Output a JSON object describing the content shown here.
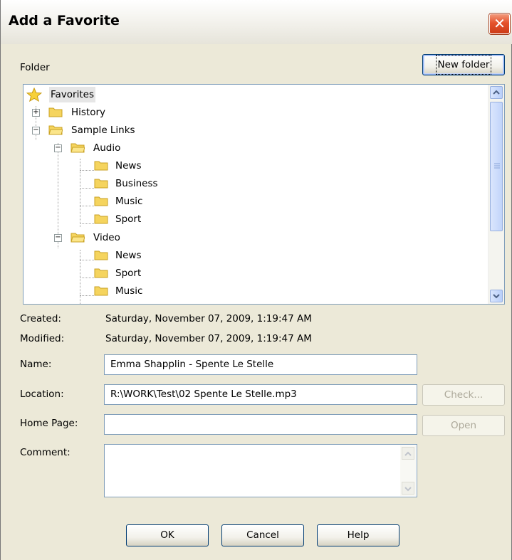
{
  "window": {
    "title": "Add a Favorite",
    "close_glyph": "✕"
  },
  "folder": {
    "label": "Folder",
    "new_folder_button": "New folder"
  },
  "tree": {
    "root": "Favorites",
    "items": [
      {
        "label": "History"
      },
      {
        "label": "Sample Links"
      },
      {
        "label": "Audio"
      },
      {
        "label": "News"
      },
      {
        "label": "Business"
      },
      {
        "label": "Music"
      },
      {
        "label": "Sport"
      },
      {
        "label": "Video"
      },
      {
        "label": "News"
      },
      {
        "label": "Sport"
      },
      {
        "label": "Music"
      }
    ]
  },
  "info": {
    "created_label": "Created:",
    "created_value": "Saturday, November 07, 2009, 1:19:47 AM",
    "modified_label": "Modified:",
    "modified_value": "Saturday, November 07, 2009, 1:19:47 AM"
  },
  "form": {
    "name_label": "Name:",
    "name_value": "Emma Shapplin - Spente Le Stelle",
    "location_label": "Location:",
    "location_value": "R:\\WORK\\Test\\02 Spente Le Stelle.mp3",
    "check_button": "Check...",
    "homepage_label": "Home Page:",
    "homepage_value": "",
    "open_button": "Open",
    "comment_label": "Comment:",
    "comment_value": ""
  },
  "buttons": {
    "ok": "OK",
    "cancel": "Cancel",
    "help": "Help"
  },
  "colors": {
    "accent": "#003c74",
    "folder": "#f5d45e",
    "close": "#e5532c"
  }
}
